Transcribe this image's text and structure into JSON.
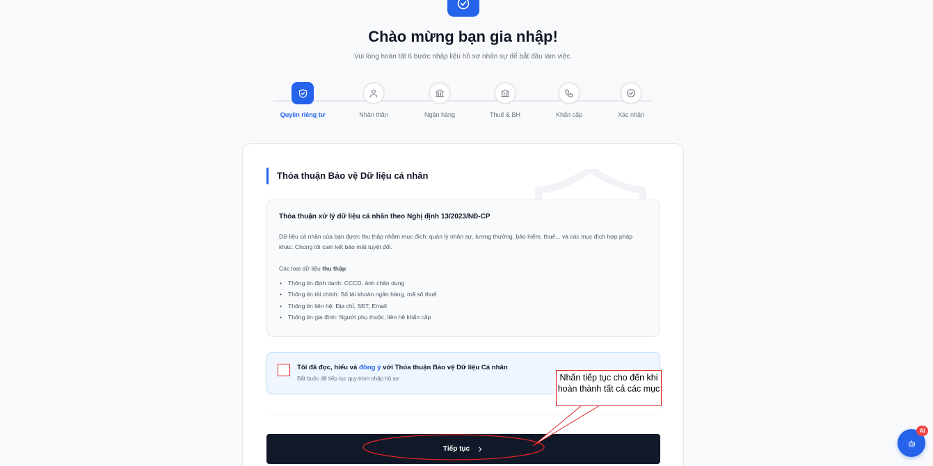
{
  "header": {
    "title": "Chào mừng bạn gia nhập!",
    "subtitle": "Vui lòng hoàn tất 6 bước nhập liệu hồ sơ nhân sự để bắt đầu làm việc."
  },
  "steps": [
    {
      "label": "Quyền riêng tư",
      "icon": "shield-check-icon",
      "active": true
    },
    {
      "label": "Nhân thân",
      "icon": "user-icon",
      "active": false
    },
    {
      "label": "Ngân hàng",
      "icon": "bank-icon",
      "active": false
    },
    {
      "label": "Thuế & BH",
      "icon": "bank-icon",
      "active": false
    },
    {
      "label": "Khẩn cấp",
      "icon": "phone-icon",
      "active": false
    },
    {
      "label": "Xác nhận",
      "icon": "check-circle-icon",
      "active": false
    }
  ],
  "card": {
    "section_title": "Thỏa thuận Bảo vệ Dữ liệu cá nhân",
    "agreement": {
      "heading": "Thỏa thuận xử lý dữ liệu cá nhân theo Nghị định 13/2023/NĐ-CP",
      "description": "Dữ liệu cá nhân của bạn được thu thập nhằm mục đích: quản lý nhân sự, lương thưởng, bảo hiểm, thuế... và các mục đích hợp pháp khác. Chúng tôi cam kết bảo mật tuyệt đối.",
      "collected_prefix": "Các loại dữ liệu ",
      "collected_bold": "thu thập",
      "collected_suffix": ":",
      "items": [
        "Thông tin định danh: CCCD, ảnh chân dung",
        "Thông tin tài chính: Số tài khoản ngân hàng, mã số thuế",
        "Thông tin liên hệ: Địa chỉ, SĐT, Email",
        "Thông tin gia đình: Người phụ thuộc, liên hệ khẩn cấp"
      ]
    },
    "consent": {
      "text_before": "Tôi đã đọc, hiểu và ",
      "link": "đồng ý",
      "text_after": " với Thỏa thuận Bảo vệ Dữ liệu Cá nhân",
      "hint": "Bắt buộc để tiếp tục quy trình nhập hồ sơ",
      "checked": false
    },
    "continue_label": "Tiếp tục"
  },
  "annotation": {
    "callout_text": "Nhấn tiếp tục cho đến khi hoàn thành tất cả các mục",
    "color": "#dc2626"
  },
  "chat": {
    "badge": "AI",
    "icon": "bot-icon"
  },
  "colors": {
    "accent": "#2563eb",
    "dark_button": "#111827",
    "annotation_red": "#dc2626"
  }
}
